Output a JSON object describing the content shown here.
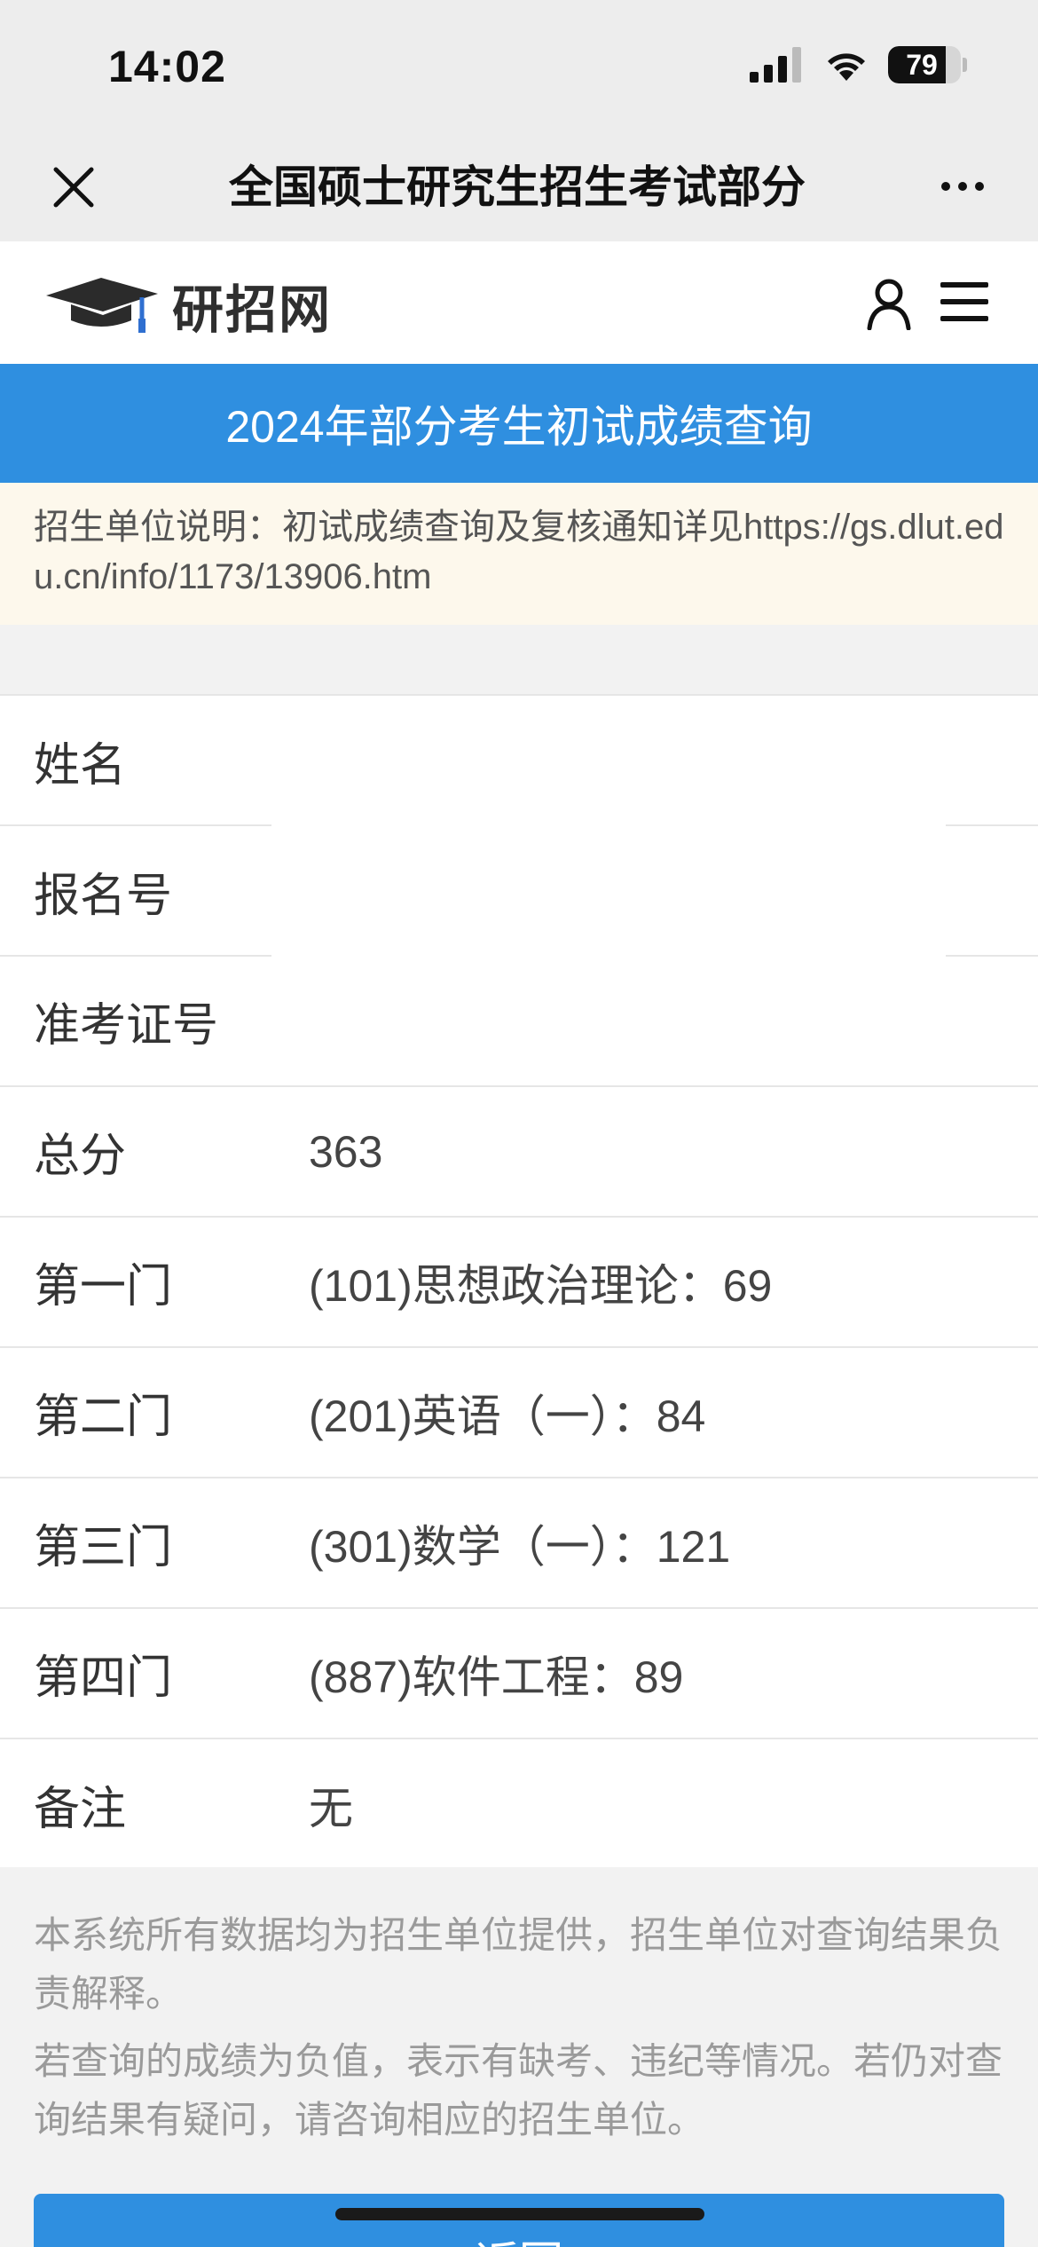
{
  "status_bar": {
    "time": "14:02",
    "battery_level": "79",
    "battery_percent": 79,
    "icons": [
      "signal-icon",
      "wifi-icon",
      "battery-icon"
    ]
  },
  "nav_bar": {
    "title": "全国硕士研究生招生考试部分",
    "icons": [
      "close-icon",
      "more-icon"
    ]
  },
  "site_header": {
    "logo_text": "研招网",
    "icons": [
      "graduation-cap-icon",
      "user-icon",
      "menu-icon"
    ]
  },
  "banner": {
    "title": "2024年部分考生初试成绩查询"
  },
  "notice": {
    "text": "招生单位说明：初试成绩查询及复核通知详见https://gs.dlut.edu.cn/info/1173/13906.htm"
  },
  "results": [
    {
      "label": "姓名",
      "value": ""
    },
    {
      "label": "报名号",
      "value": ""
    },
    {
      "label": "准考证号",
      "value": ""
    },
    {
      "label": "总分",
      "value": "363"
    },
    {
      "label": "第一门",
      "value": "(101)思想政治理论：69"
    },
    {
      "label": "第二门",
      "value": "(201)英语（一）：84"
    },
    {
      "label": "第三门",
      "value": "(301)数学（一）：121"
    },
    {
      "label": "第四门",
      "value": "(887)软件工程：89"
    },
    {
      "label": "备注",
      "value": "无"
    }
  ],
  "footer": {
    "note1": "本系统所有数据均为招生单位提供，招生单位对查询结果负责解释。",
    "note2": "若查询的成绩为负值，表示有缺考、违纪等情况。若仍对查询结果有疑问，请咨询相应的招生单位。"
  },
  "back_button": {
    "label": "返回"
  },
  "colors": {
    "accent": "#2f8fe0",
    "notice_bg": "#fdf8ec",
    "chrome_bg": "#ededed"
  }
}
